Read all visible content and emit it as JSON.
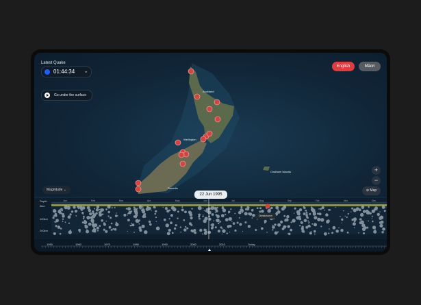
{
  "latest_quake": {
    "label": "Latest Quake",
    "time": "01:44:34"
  },
  "surface_button": "Go under the surface",
  "languages": {
    "english": "English",
    "maori": "Māori"
  },
  "zoom": {
    "in": "+",
    "out": "−"
  },
  "map_button": "Map",
  "magnitude_button": "Magnitude",
  "selected_date": "22 Jun 1995",
  "place_labels": [
    "Auckland",
    "Wellington",
    "Dunedin",
    "Chatham Islands"
  ],
  "depth_labels": [
    "Depth",
    "0km",
    "100km",
    "200km"
  ],
  "months": [
    "Jan",
    "Feb",
    "Mar",
    "Apr",
    "May",
    "Jun",
    "Jul",
    "Aug",
    "Sep",
    "Oct",
    "Nov",
    "Dec"
  ],
  "years": [
    "1950",
    "1960",
    "1970",
    "1980",
    "1990",
    "2000",
    "2010",
    "Today"
  ],
  "tooltip": "Christchurch",
  "colors": {
    "accent": "#e13a3f",
    "quake_marker": "#d9433f",
    "surface_line": "#e9ef7a"
  }
}
